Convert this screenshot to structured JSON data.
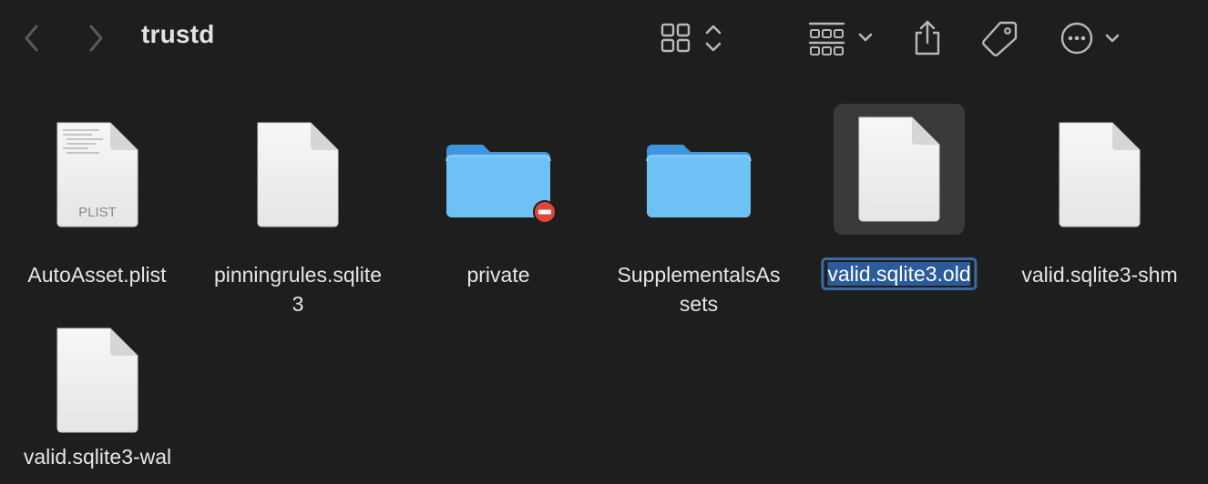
{
  "window": {
    "title": "trustd"
  },
  "toolbar": {
    "back_icon": "chevron-left-icon",
    "forward_icon": "chevron-right-icon",
    "view_icon": "icon-grid-view-icon",
    "group_icon": "group-by-icon",
    "share_icon": "share-icon",
    "tag_icon": "tag-icon",
    "more_icon": "ellipsis-circle-icon"
  },
  "colors": {
    "background": "#1f1e1e",
    "selection": "#3a3a3a",
    "rename_border": "#3d6aa3",
    "rename_highlight": "#2b5b9a",
    "folder": "#6ec1f5",
    "badge": "#e0453a"
  },
  "files": [
    {
      "name": "AutoAsset.plist",
      "kind": "plist",
      "badge": "PLIST"
    },
    {
      "name": "pinningrules.sqlite3",
      "kind": "document"
    },
    {
      "name": "private",
      "kind": "folder",
      "restricted": true
    },
    {
      "name": "SupplementalsAssets",
      "kind": "folder"
    },
    {
      "name": "valid.sqlite3.old",
      "kind": "document",
      "selected": true,
      "renaming": true
    },
    {
      "name": "valid.sqlite3-shm",
      "kind": "document"
    },
    {
      "name": "valid.sqlite3-wal",
      "kind": "document"
    }
  ]
}
